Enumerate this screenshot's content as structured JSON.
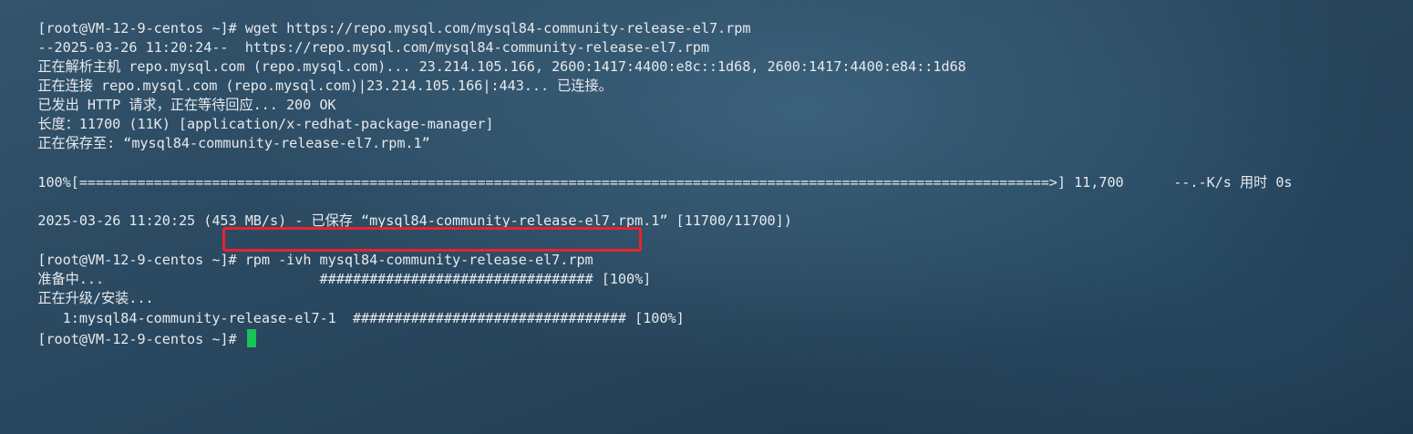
{
  "terminal": {
    "lines": [
      {
        "prompt": "[root@VM-12-9-centos ~]# ",
        "cmd": "wget https://repo.mysql.com/mysql84-community-release-el7.rpm"
      },
      {
        "text": "--2025-03-26 11:20:24--  https://repo.mysql.com/mysql84-community-release-el7.rpm"
      },
      {
        "text": "正在解析主机 repo.mysql.com (repo.mysql.com)... 23.214.105.166, 2600:1417:4400:e8c::1d68, 2600:1417:4400:e84::1d68"
      },
      {
        "text": "正在连接 repo.mysql.com (repo.mysql.com)|23.214.105.166|:443... 已连接。"
      },
      {
        "text": "已发出 HTTP 请求，正在等待回应... 200 OK"
      },
      {
        "text": "长度：11700 (11K) [application/x-redhat-package-manager]"
      },
      {
        "text": "正在保存至: “mysql84-community-release-el7.rpm.1”"
      },
      {
        "text": ""
      },
      {
        "text": "100%[=====================================================================================================================>] 11,700      --.-K/s 用时 0s"
      },
      {
        "text": ""
      },
      {
        "text": "2025-03-26 11:20:25 (453 MB/s) - 已保存 “mysql84-community-release-el7.rpm.1” [11700/11700])"
      },
      {
        "text": ""
      },
      {
        "prompt": "[root@VM-12-9-centos ~]# ",
        "cmd": "rpm -ivh mysql84-community-release-el7.rpm"
      },
      {
        "text": "准备中...                          ################################# [100%]"
      },
      {
        "text": "正在升级/安装..."
      },
      {
        "text": "   1:mysql84-community-release-el7-1  ################################# [100%]"
      },
      {
        "prompt": "[root@VM-12-9-centos ~]# ",
        "cmd": ""
      }
    ]
  },
  "colors": {
    "text": "#e6e9ec",
    "cursor": "#18c35a",
    "highlight": "#e8232d"
  }
}
